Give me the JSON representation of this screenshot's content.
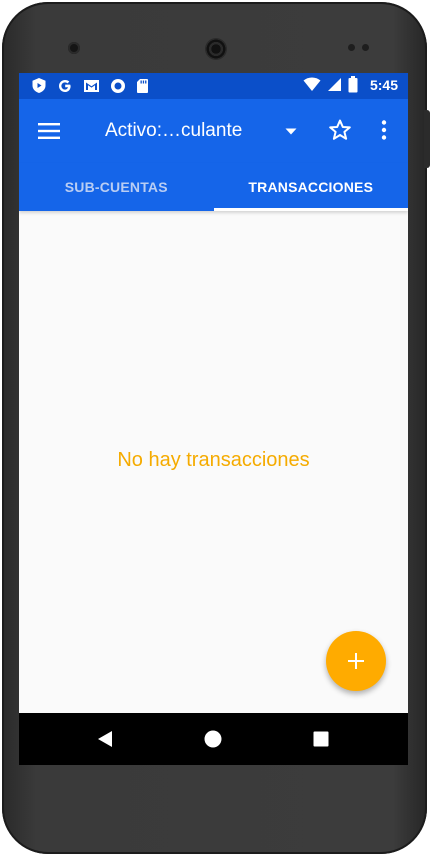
{
  "status_bar": {
    "time": "5:45",
    "left_icons": [
      "shield-icon",
      "google-icon",
      "gmail-icon",
      "circle-icon",
      "sd-card-icon"
    ],
    "right_icons": [
      "wifi-icon",
      "signal-icon",
      "battery-icon"
    ]
  },
  "app_bar": {
    "title": "Activo:…culante",
    "menu_icon": "hamburger-menu-icon",
    "dropdown_icon": "dropdown-arrow-icon",
    "star_icon": "star-outline-icon",
    "more_icon": "more-vert-icon"
  },
  "tabs": [
    {
      "label": "SUB-CUENTAS",
      "active": false
    },
    {
      "label": "TRANSACCIONES",
      "active": true
    }
  ],
  "content": {
    "empty_message": "No hay transacciones"
  },
  "fab": {
    "icon": "plus-icon"
  },
  "nav_bar": {
    "icons": [
      "back-icon",
      "home-icon",
      "recents-icon"
    ]
  },
  "colors": {
    "status_bar": "#0b4fc9",
    "app_bar": "#1565e9",
    "accent": "#ffab00",
    "empty_text": "#f5ab00",
    "background": "#fafafa"
  }
}
